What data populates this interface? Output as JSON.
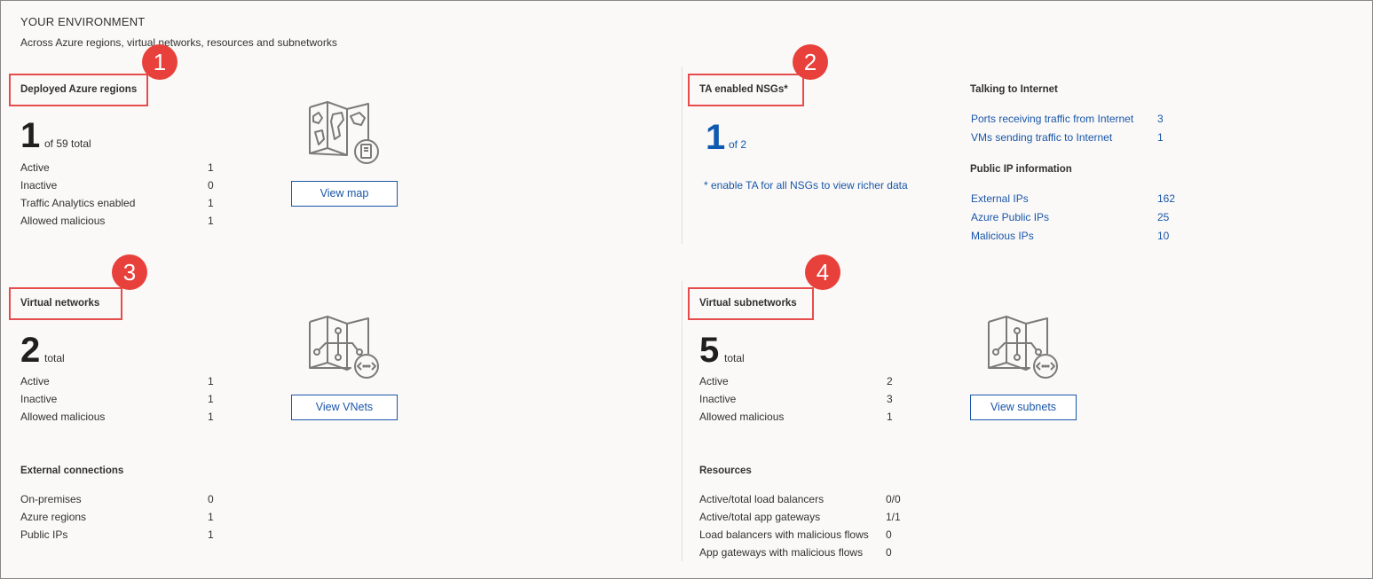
{
  "header": {
    "title": "YOUR ENVIRONMENT",
    "subtitle": "Across Azure regions, virtual networks, resources and subnetworks"
  },
  "badges": [
    "1",
    "2",
    "3",
    "4"
  ],
  "regions": {
    "title": "Deployed Azure regions",
    "count": "1",
    "count_suffix": "of 59 total",
    "rows": [
      {
        "label": "Active",
        "value": "1"
      },
      {
        "label": "Inactive",
        "value": "0"
      },
      {
        "label": "Traffic Analytics enabled",
        "value": "1"
      },
      {
        "label": "Allowed malicious",
        "value": "1"
      }
    ],
    "button": "View map",
    "icon": "world-map-icon"
  },
  "nsgs": {
    "title": "TA enabled NSGs*",
    "count": "1",
    "count_suffix": "of 2",
    "note": "* enable TA for all NSGs to view richer data"
  },
  "internet": {
    "title": "Talking to Internet",
    "rows": [
      {
        "label": "Ports receiving traffic from Internet",
        "value": "3"
      },
      {
        "label": "VMs sending traffic to Internet",
        "value": "1"
      }
    ],
    "public_ip_title": "Public IP information",
    "public_ip_rows": [
      {
        "label": "External IPs",
        "value": "162"
      },
      {
        "label": "Azure Public IPs",
        "value": "25"
      },
      {
        "label": "Malicious IPs",
        "value": "10"
      }
    ]
  },
  "vnets": {
    "title": "Virtual networks",
    "count": "2",
    "count_suffix": "total",
    "rows": [
      {
        "label": "Active",
        "value": "1"
      },
      {
        "label": "Inactive",
        "value": "1"
      },
      {
        "label": "Allowed malicious",
        "value": "1"
      }
    ],
    "button": "View VNets",
    "icon": "vnet-map-icon",
    "external_title": "External connections",
    "external_rows": [
      {
        "label": "On-premises",
        "value": "0"
      },
      {
        "label": "Azure regions",
        "value": "1"
      },
      {
        "label": "Public IPs",
        "value": "1"
      }
    ]
  },
  "subnets": {
    "title": "Virtual subnetworks",
    "count": "5",
    "count_suffix": "total",
    "rows": [
      {
        "label": "Active",
        "value": "2"
      },
      {
        "label": "Inactive",
        "value": "3"
      },
      {
        "label": "Allowed malicious",
        "value": "1"
      }
    ],
    "button": "View subnets",
    "icon": "subnet-map-icon",
    "resources_title": "Resources",
    "resources_rows": [
      {
        "label": "Active/total load balancers",
        "value": "0/0"
      },
      {
        "label": "Active/total app gateways",
        "value": "1/1"
      },
      {
        "label": "Load balancers with malicious flows",
        "value": "0"
      },
      {
        "label": "App gateways with malicious flows",
        "value": "0"
      }
    ]
  },
  "colors": {
    "accent": "#1a56a8",
    "highlight_red": "#e8413b",
    "background": "#faf9f8"
  }
}
